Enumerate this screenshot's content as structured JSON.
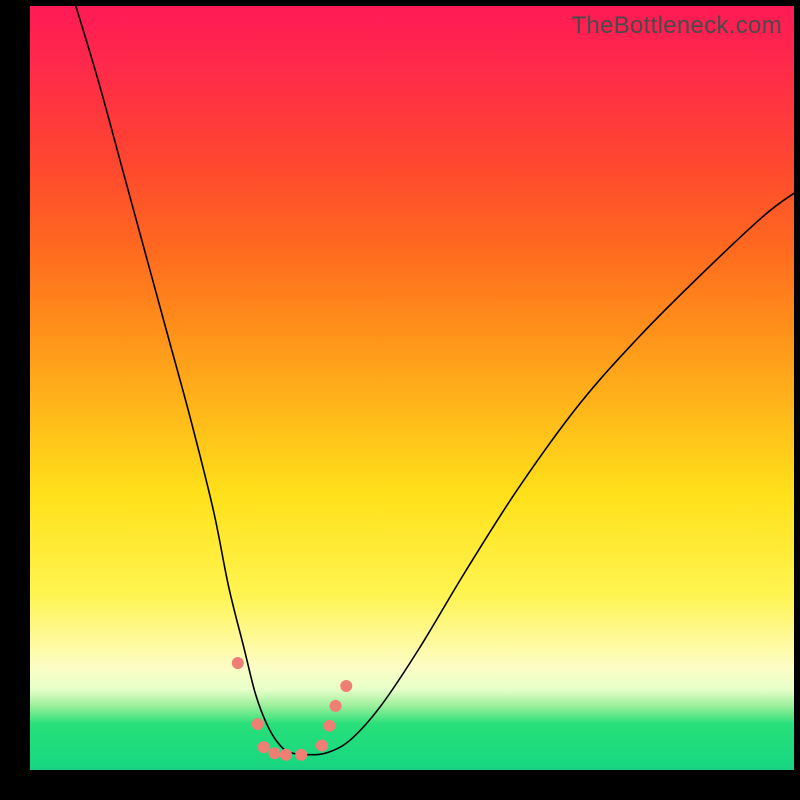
{
  "watermark": "TheBottleneck.com",
  "colors": {
    "dot": "#ef7f75",
    "curve": "#000000"
  },
  "chart_data": {
    "type": "line",
    "title": "",
    "xlabel": "",
    "ylabel": "",
    "xlim": [
      0,
      100
    ],
    "ylim": [
      0,
      100
    ],
    "grid": false,
    "legend": false,
    "note": "Single unlabeled V-shaped curve on a vertical rainbow gradient. x is horizontal position (0=left,100=right of plot area), y is vertical position (0=bottom,100=top). Values estimated from pixels.",
    "series": [
      {
        "name": "curve",
        "x": [
          6,
          9,
          12,
          15,
          18,
          21,
          24,
          26,
          28,
          29.5,
          31,
          32.5,
          34,
          36.5,
          39,
          42,
          46,
          51,
          57,
          64,
          72,
          80,
          88,
          96,
          100
        ],
        "y": [
          100,
          90,
          79,
          68,
          57,
          46,
          34,
          24,
          16,
          10,
          6,
          3.5,
          2.3,
          2.0,
          2.3,
          4.0,
          8.5,
          16,
          26,
          37,
          48,
          57,
          65,
          72.5,
          75.5
        ]
      }
    ],
    "points": {
      "name": "dots",
      "note": "Small salmon-colored markers clustered near the valley bottom",
      "x": [
        27.2,
        29.8,
        30.6,
        32.0,
        33.5,
        35.5,
        38.2,
        39.2,
        40.0,
        41.4
      ],
      "y": [
        14.0,
        6.0,
        3.0,
        2.2,
        2.0,
        2.0,
        3.2,
        5.8,
        8.4,
        11.0
      ]
    }
  }
}
